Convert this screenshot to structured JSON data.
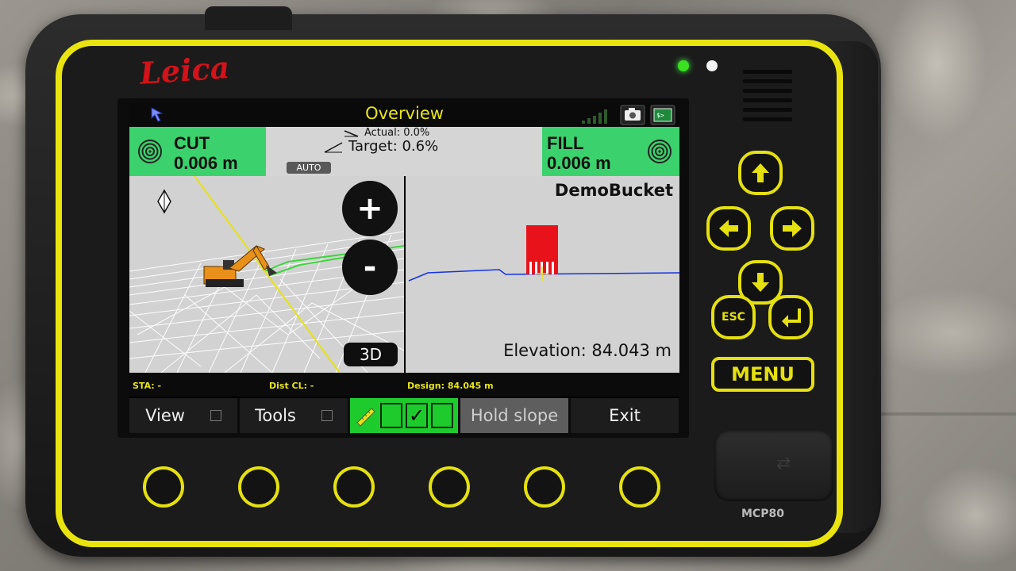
{
  "device": {
    "brand": "Leica",
    "model": "MCP80",
    "menu_key": "MENU",
    "esc_key": "ESC"
  },
  "screen": {
    "title": "Overview",
    "cut": {
      "label": "CUT",
      "value": "0.006 m"
    },
    "fill": {
      "label": "FILL",
      "value": "0.006 m"
    },
    "slope": {
      "actual": "Actual: 0.0%",
      "target": "Target: 0.6%",
      "mode": "AUTO"
    },
    "view3d": {
      "zoom_in": "+",
      "zoom_out": "-",
      "mode_button": "3D"
    },
    "profile": {
      "bucket_name": "DemoBucket",
      "elevation": "Elevation: 84.043 m"
    },
    "info": {
      "sta": "STA: -",
      "dist_cl": "Dist CL: -",
      "design": "Design: 84.045 m"
    },
    "softkeys": {
      "view": "View",
      "tools": "Tools",
      "check_mark": "✓",
      "hold_slope": "Hold slope",
      "exit": "Exit"
    }
  },
  "colors": {
    "accent_yellow": "#e9e40e",
    "cut_fill_green": "#3bd26d",
    "bucket_red": "#e8121a",
    "profile_line_blue": "#1432e0"
  }
}
